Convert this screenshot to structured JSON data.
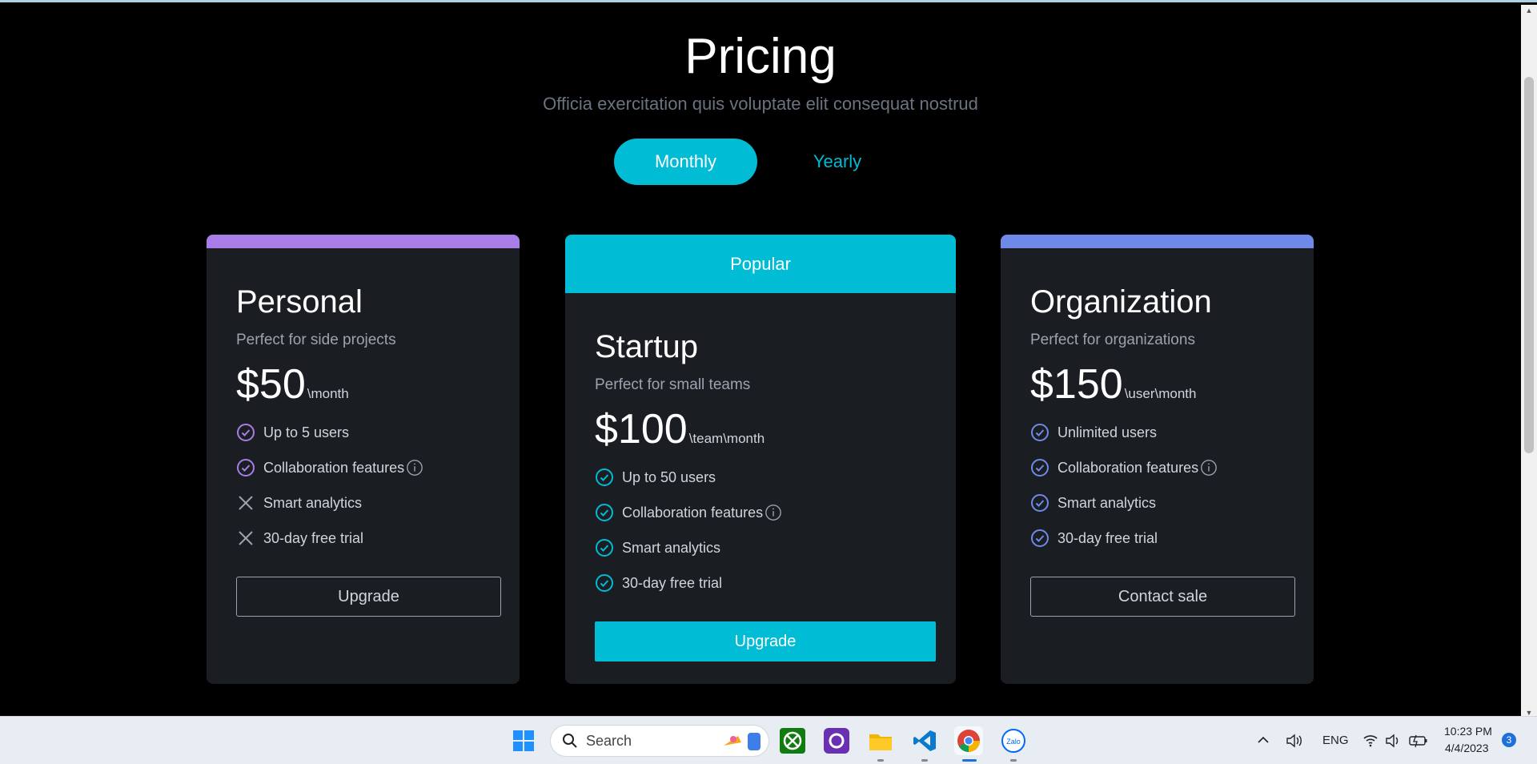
{
  "page": {
    "title": "Pricing",
    "subtitle": "Officia exercitation quis voluptate elit consequat nostrud"
  },
  "toggle": {
    "monthly_label": "Monthly",
    "yearly_label": "Yearly",
    "active": "monthly"
  },
  "colors": {
    "accent": "#00bcd4",
    "personal_accent": "#a87de8",
    "org_accent": "#6f89e8",
    "card_bg": "#1a1d21"
  },
  "plans": [
    {
      "name": "Personal",
      "description": "Perfect for side projects",
      "price": "$50",
      "unit": "\\month",
      "features": [
        {
          "label": "Up to 5 users",
          "included": true,
          "info": false
        },
        {
          "label": "Collaboration features",
          "included": true,
          "info": true
        },
        {
          "label": "Smart analytics",
          "included": false,
          "info": false
        },
        {
          "label": "30-day free trial",
          "included": false,
          "info": false
        }
      ],
      "button_label": "Upgrade"
    },
    {
      "badge": "Popular",
      "name": "Startup",
      "description": "Perfect for small teams",
      "price": "$100",
      "unit": "\\team\\month",
      "features": [
        {
          "label": "Up to 50 users",
          "included": true,
          "info": false
        },
        {
          "label": "Collaboration features",
          "included": true,
          "info": true
        },
        {
          "label": "Smart analytics",
          "included": true,
          "info": false
        },
        {
          "label": "30-day free trial",
          "included": true,
          "info": false
        }
      ],
      "button_label": "Upgrade"
    },
    {
      "name": "Organization",
      "description": "Perfect for organizations",
      "price": "$150",
      "unit": "\\user\\month",
      "features": [
        {
          "label": "Unlimited users",
          "included": true,
          "info": false
        },
        {
          "label": "Collaboration features",
          "included": true,
          "info": true
        },
        {
          "label": "Smart analytics",
          "included": true,
          "info": false
        },
        {
          "label": "30-day free trial",
          "included": true,
          "info": false
        }
      ],
      "button_label": "Contact sale"
    }
  ],
  "taskbar": {
    "search_label": "Search",
    "language": "ENG",
    "time": "10:23 PM",
    "date": "4/4/2023",
    "notification_count": "3",
    "apps": [
      "windows-start-icon",
      "xbox-icon",
      "clipchamp-icon",
      "file-explorer-icon",
      "vscode-icon",
      "chrome-icon",
      "zalo-icon"
    ]
  }
}
